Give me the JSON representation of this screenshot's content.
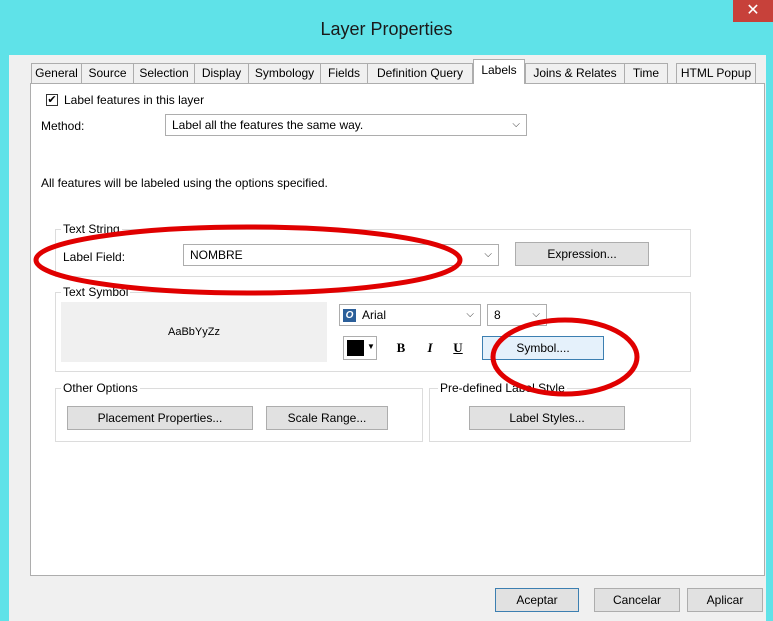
{
  "window": {
    "title": "Layer Properties",
    "close_glyph": "✕"
  },
  "tabs": [
    "General",
    "Source",
    "Selection",
    "Display",
    "Symbology",
    "Fields",
    "Definition Query",
    "Labels",
    "Joins & Relates",
    "Time",
    "HTML Popup"
  ],
  "active_tab": "Labels",
  "label_checkbox": {
    "label": "Label features in this layer",
    "checked": true
  },
  "method": {
    "label": "Method:",
    "value": "Label all the features the same way."
  },
  "info_text": "All features will be labeled using the options specified.",
  "text_string": {
    "legend": "Text String",
    "field_label": "Label Field:",
    "field_value": "NOMBRE",
    "expression_button": "Expression..."
  },
  "text_symbol": {
    "legend": "Text Symbol",
    "preview": "AaBbYyZz",
    "font": "Arial",
    "size": "8",
    "color": "#000000",
    "bold": "B",
    "italic": "I",
    "underline": "U",
    "symbol_button": "Symbol...."
  },
  "other_options": {
    "legend": "Other Options",
    "placement_button": "Placement Properties...",
    "scale_button": "Scale Range..."
  },
  "predefined": {
    "legend": "Pre-defined Label Style",
    "styles_button": "Label Styles..."
  },
  "footer": {
    "ok": "Aceptar",
    "cancel": "Cancelar",
    "apply": "Aplicar"
  },
  "annotations": {
    "color": "#e00000"
  }
}
